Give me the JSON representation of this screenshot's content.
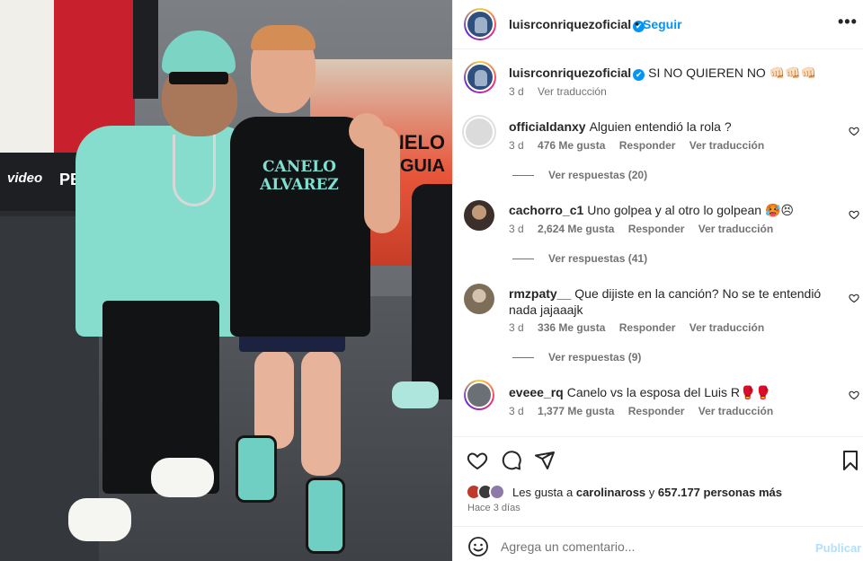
{
  "post": {
    "header": {
      "username": "luisrconriquezoficial",
      "verified": "✔",
      "dot": "•",
      "follow": "Seguir",
      "more": "•••"
    },
    "photo_labels": {
      "pbc": "PBC",
      "video": "video",
      "canelo": "CANELO",
      "munguia": "MUNGUIA",
      "shirt_text": "CANELO ALVAREZ"
    },
    "caption": {
      "username": "luisrconriquezoficial",
      "text": "SI NO QUIEREN NO 👊🏻👊🏻👊🏻",
      "time": "3 d",
      "translate": "Ver traducción"
    },
    "comments": [
      {
        "username": "officialdanxy",
        "text": "Alguien entendió la rola ?",
        "time": "3 d",
        "likes": "476 Me gusta",
        "reply": "Responder",
        "translate": "Ver traducción",
        "replies": "Ver respuestas (20)"
      },
      {
        "username": "cachorro_c1",
        "text": "Uno golpea y al otro lo golpean 🥵😣",
        "time": "3 d",
        "likes": "2,624 Me gusta",
        "reply": "Responder",
        "translate": "Ver traducción",
        "replies": "Ver respuestas (41)"
      },
      {
        "username": "rmzpaty__",
        "text": "Que dijiste en la canción? No se te entendió nada jajaaajk",
        "time": "3 d",
        "likes": "336 Me gusta",
        "reply": "Responder",
        "translate": "Ver traducción",
        "replies": "Ver respuestas (9)"
      },
      {
        "username": "eveee_rq",
        "text": "Canelo vs la esposa del Luis R🥊🥊",
        "time": "3 d",
        "likes": "1,377 Me gusta",
        "reply": "Responder",
        "translate": "Ver traducción"
      }
    ],
    "actions": {
      "likes_prefix": "Les gusta a",
      "liker_name": "carolinaross",
      "likes_mid": "y",
      "likes_count": "657.177 personas más",
      "time_ago": "Hace 3 días"
    },
    "add_comment": {
      "placeholder": "Agrega un comentario...",
      "publish": "Publicar"
    },
    "colors": {
      "link": "#0095f6",
      "muted": "#737373",
      "publish_disabled": "#b2dffc"
    },
    "icons": [
      "heart-icon",
      "comment-icon",
      "share-icon",
      "bookmark-icon",
      "emoji-icon",
      "more-icon",
      "verified-icon"
    ]
  }
}
